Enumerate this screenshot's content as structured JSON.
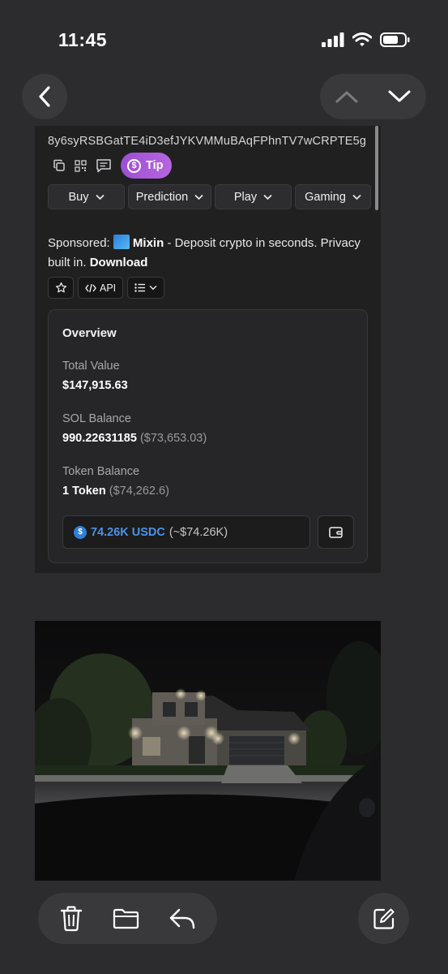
{
  "status_bar": {
    "time": "11:45"
  },
  "card": {
    "address": "8y6syRSBGatTE4iD3efJYKVMMuBAqFPhnTV7wCRPTE5g",
    "tip_label": "Tip",
    "menu": [
      "Buy",
      "Prediction",
      "Play",
      "Gaming"
    ],
    "sponsored": {
      "prefix": "Sponsored:",
      "brand": "Mixin",
      "text": " - Deposit crypto in seconds. Privacy built in. ",
      "cta": "Download"
    },
    "tools": {
      "api_label": "API"
    },
    "overview": {
      "title": "Overview",
      "total_value_label": "Total Value",
      "total_value": "$147,915.63",
      "sol_balance_label": "SOL Balance",
      "sol_balance": "990.22631185",
      "sol_balance_usd": "($73,653.03)",
      "token_balance_label": "Token Balance",
      "token_balance": "1 Token",
      "token_balance_usd": "($74,262.6)",
      "usdc_amount": "74.26K USDC",
      "usdc_approx": "(~$74.26K)"
    }
  },
  "colors": {
    "tip_gradient_start": "#9d4fd3",
    "usdc_blue": "#4d92e6"
  },
  "icons": [
    "back-chevron-icon",
    "up-chevron-icon",
    "down-chevron-icon",
    "copy-icon",
    "qr-code-icon",
    "comment-icon",
    "star-icon",
    "code-icon",
    "list-icon",
    "wallet-icon",
    "trash-icon",
    "folder-icon",
    "reply-icon",
    "compose-icon"
  ]
}
